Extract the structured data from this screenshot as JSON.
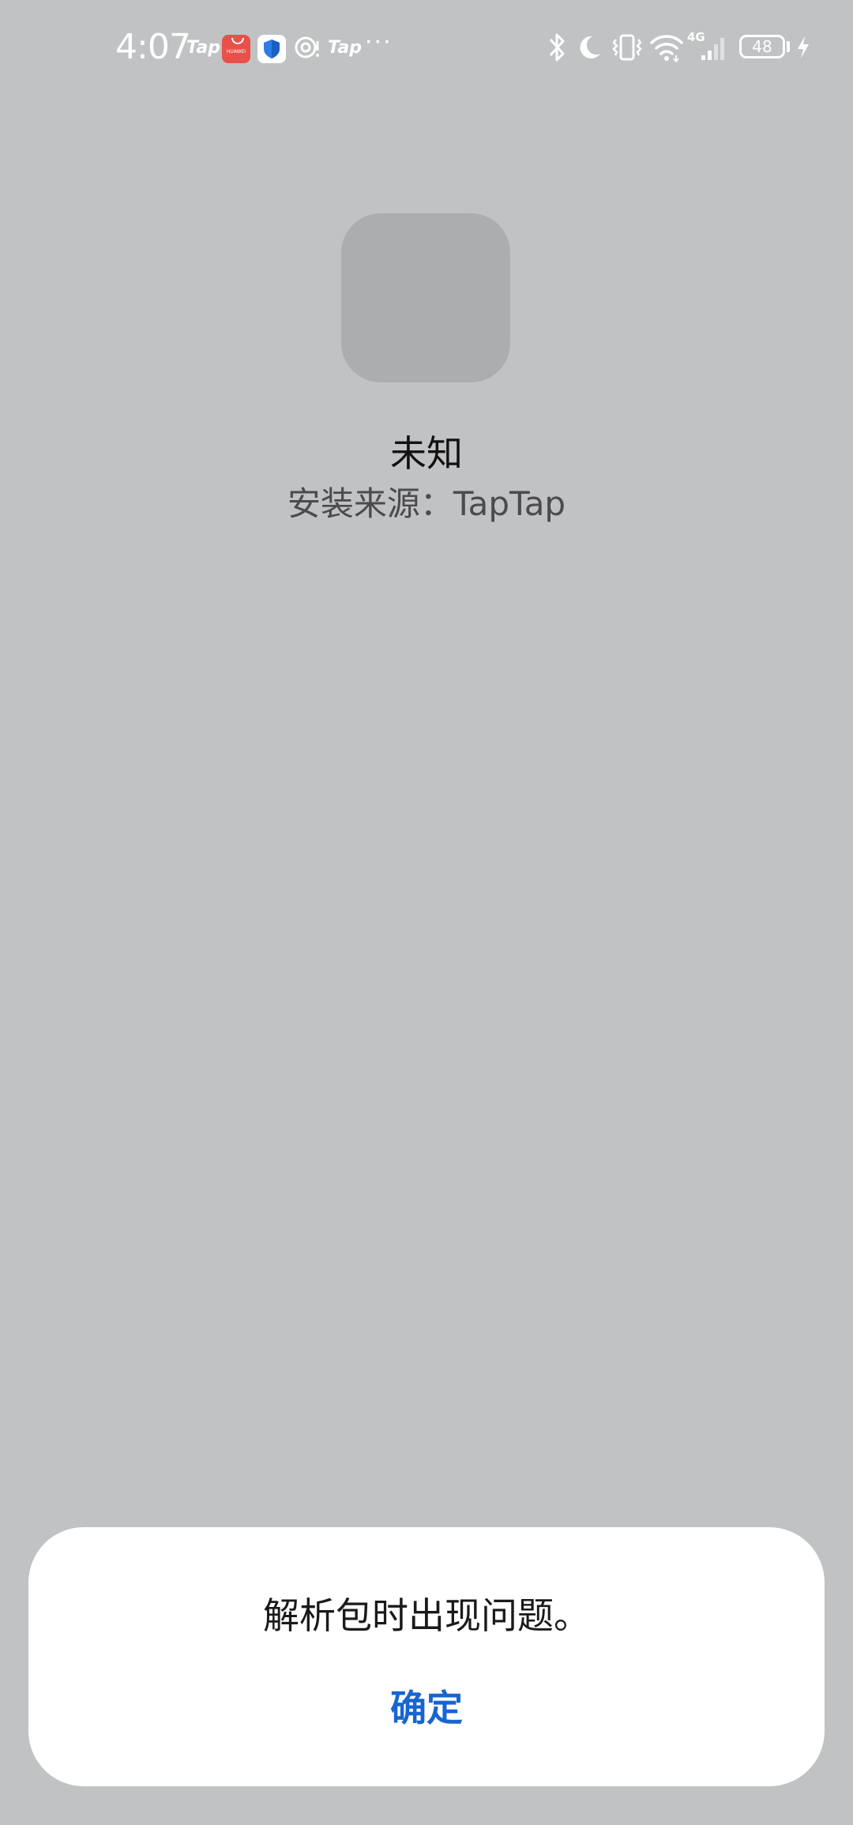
{
  "status_bar": {
    "time": "4:07",
    "tap_label_1": "Tap",
    "tap_label_2": "Tap",
    "huawei_brand": "HUAWEI",
    "more": "···",
    "network": "4G",
    "battery_level": "48",
    "icons": [
      "tap-icon",
      "huawei-appgallery-icon",
      "shield-icon",
      "target-icon",
      "tap-icon",
      "more-icon",
      "bluetooth-icon",
      "moon-icon",
      "vibrate-icon",
      "wifi-icon",
      "signal-icon",
      "battery-icon",
      "charging-icon"
    ]
  },
  "app": {
    "name": "未知",
    "install_source": "安装来源：TapTap"
  },
  "dialog": {
    "message": "解析包时出现问题。",
    "confirm_label": "确定"
  },
  "colors": {
    "background": "#c1c2c4",
    "icon_placeholder": "#acadaf",
    "dialog_bg": "#ffffff",
    "accent": "#1765d0"
  }
}
